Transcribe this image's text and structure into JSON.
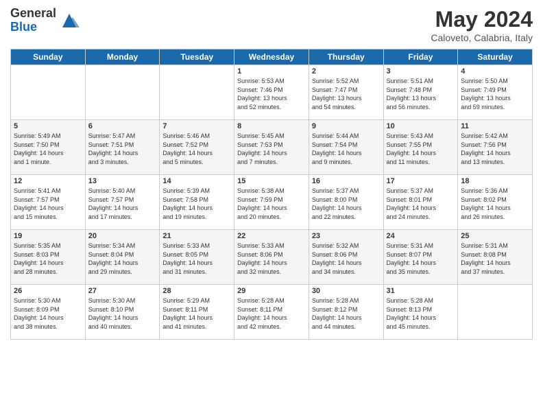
{
  "header": {
    "logo": {
      "general": "General",
      "blue": "Blue"
    },
    "title": "May 2024",
    "subtitle": "Caloveto, Calabria, Italy"
  },
  "calendar": {
    "days_of_week": [
      "Sunday",
      "Monday",
      "Tuesday",
      "Wednesday",
      "Thursday",
      "Friday",
      "Saturday"
    ],
    "weeks": [
      [
        {
          "day": "",
          "info": ""
        },
        {
          "day": "",
          "info": ""
        },
        {
          "day": "",
          "info": ""
        },
        {
          "day": "1",
          "info": "Sunrise: 5:53 AM\nSunset: 7:46 PM\nDaylight: 13 hours\nand 52 minutes."
        },
        {
          "day": "2",
          "info": "Sunrise: 5:52 AM\nSunset: 7:47 PM\nDaylight: 13 hours\nand 54 minutes."
        },
        {
          "day": "3",
          "info": "Sunrise: 5:51 AM\nSunset: 7:48 PM\nDaylight: 13 hours\nand 56 minutes."
        },
        {
          "day": "4",
          "info": "Sunrise: 5:50 AM\nSunset: 7:49 PM\nDaylight: 13 hours\nand 59 minutes."
        }
      ],
      [
        {
          "day": "5",
          "info": "Sunrise: 5:49 AM\nSunset: 7:50 PM\nDaylight: 14 hours\nand 1 minute."
        },
        {
          "day": "6",
          "info": "Sunrise: 5:47 AM\nSunset: 7:51 PM\nDaylight: 14 hours\nand 3 minutes."
        },
        {
          "day": "7",
          "info": "Sunrise: 5:46 AM\nSunset: 7:52 PM\nDaylight: 14 hours\nand 5 minutes."
        },
        {
          "day": "8",
          "info": "Sunrise: 5:45 AM\nSunset: 7:53 PM\nDaylight: 14 hours\nand 7 minutes."
        },
        {
          "day": "9",
          "info": "Sunrise: 5:44 AM\nSunset: 7:54 PM\nDaylight: 14 hours\nand 9 minutes."
        },
        {
          "day": "10",
          "info": "Sunrise: 5:43 AM\nSunset: 7:55 PM\nDaylight: 14 hours\nand 11 minutes."
        },
        {
          "day": "11",
          "info": "Sunrise: 5:42 AM\nSunset: 7:56 PM\nDaylight: 14 hours\nand 13 minutes."
        }
      ],
      [
        {
          "day": "12",
          "info": "Sunrise: 5:41 AM\nSunset: 7:57 PM\nDaylight: 14 hours\nand 15 minutes."
        },
        {
          "day": "13",
          "info": "Sunrise: 5:40 AM\nSunset: 7:57 PM\nDaylight: 14 hours\nand 17 minutes."
        },
        {
          "day": "14",
          "info": "Sunrise: 5:39 AM\nSunset: 7:58 PM\nDaylight: 14 hours\nand 19 minutes."
        },
        {
          "day": "15",
          "info": "Sunrise: 5:38 AM\nSunset: 7:59 PM\nDaylight: 14 hours\nand 20 minutes."
        },
        {
          "day": "16",
          "info": "Sunrise: 5:37 AM\nSunset: 8:00 PM\nDaylight: 14 hours\nand 22 minutes."
        },
        {
          "day": "17",
          "info": "Sunrise: 5:37 AM\nSunset: 8:01 PM\nDaylight: 14 hours\nand 24 minutes."
        },
        {
          "day": "18",
          "info": "Sunrise: 5:36 AM\nSunset: 8:02 PM\nDaylight: 14 hours\nand 26 minutes."
        }
      ],
      [
        {
          "day": "19",
          "info": "Sunrise: 5:35 AM\nSunset: 8:03 PM\nDaylight: 14 hours\nand 28 minutes."
        },
        {
          "day": "20",
          "info": "Sunrise: 5:34 AM\nSunset: 8:04 PM\nDaylight: 14 hours\nand 29 minutes."
        },
        {
          "day": "21",
          "info": "Sunrise: 5:33 AM\nSunset: 8:05 PM\nDaylight: 14 hours\nand 31 minutes."
        },
        {
          "day": "22",
          "info": "Sunrise: 5:33 AM\nSunset: 8:06 PM\nDaylight: 14 hours\nand 32 minutes."
        },
        {
          "day": "23",
          "info": "Sunrise: 5:32 AM\nSunset: 8:06 PM\nDaylight: 14 hours\nand 34 minutes."
        },
        {
          "day": "24",
          "info": "Sunrise: 5:31 AM\nSunset: 8:07 PM\nDaylight: 14 hours\nand 35 minutes."
        },
        {
          "day": "25",
          "info": "Sunrise: 5:31 AM\nSunset: 8:08 PM\nDaylight: 14 hours\nand 37 minutes."
        }
      ],
      [
        {
          "day": "26",
          "info": "Sunrise: 5:30 AM\nSunset: 8:09 PM\nDaylight: 14 hours\nand 38 minutes."
        },
        {
          "day": "27",
          "info": "Sunrise: 5:30 AM\nSunset: 8:10 PM\nDaylight: 14 hours\nand 40 minutes."
        },
        {
          "day": "28",
          "info": "Sunrise: 5:29 AM\nSunset: 8:11 PM\nDaylight: 14 hours\nand 41 minutes."
        },
        {
          "day": "29",
          "info": "Sunrise: 5:28 AM\nSunset: 8:11 PM\nDaylight: 14 hours\nand 42 minutes."
        },
        {
          "day": "30",
          "info": "Sunrise: 5:28 AM\nSunset: 8:12 PM\nDaylight: 14 hours\nand 44 minutes."
        },
        {
          "day": "31",
          "info": "Sunrise: 5:28 AM\nSunset: 8:13 PM\nDaylight: 14 hours\nand 45 minutes."
        },
        {
          "day": "",
          "info": ""
        }
      ]
    ]
  }
}
